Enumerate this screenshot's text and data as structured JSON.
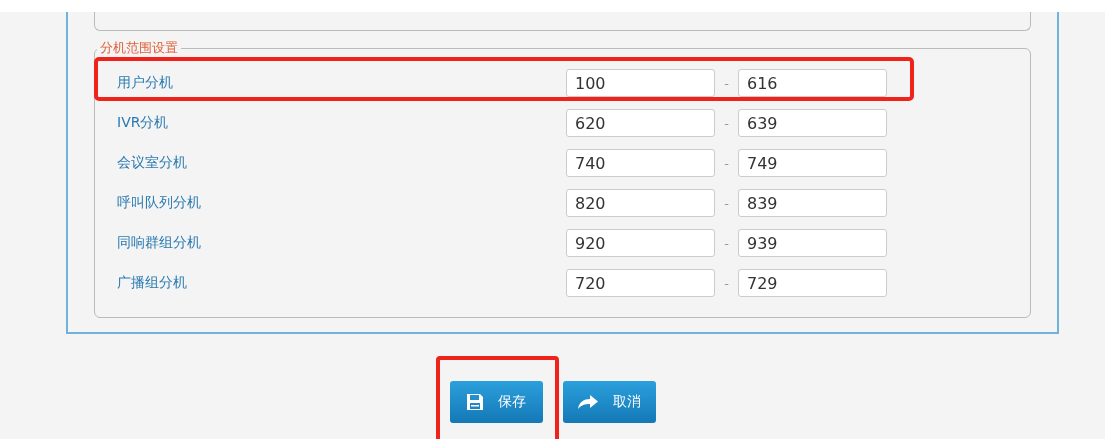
{
  "section": {
    "legend": "分机范围设置",
    "rows": [
      {
        "label": "用户分机",
        "from": "100",
        "to": "616",
        "highlighted": true
      },
      {
        "label": "IVR分机",
        "from": "620",
        "to": "639",
        "highlighted": false
      },
      {
        "label": "会议室分机",
        "from": "740",
        "to": "749",
        "highlighted": false
      },
      {
        "label": "呼叫队列分机",
        "from": "820",
        "to": "839",
        "highlighted": false
      },
      {
        "label": "同响群组分机",
        "from": "920",
        "to": "939",
        "highlighted": false
      },
      {
        "label": "广播组分机",
        "from": "720",
        "to": "729",
        "highlighted": false
      }
    ],
    "separator": "-"
  },
  "buttons": [
    {
      "kind": "save",
      "label": "保存",
      "highlighted": true
    },
    {
      "kind": "cancel",
      "label": "取消",
      "highlighted": false
    }
  ]
}
